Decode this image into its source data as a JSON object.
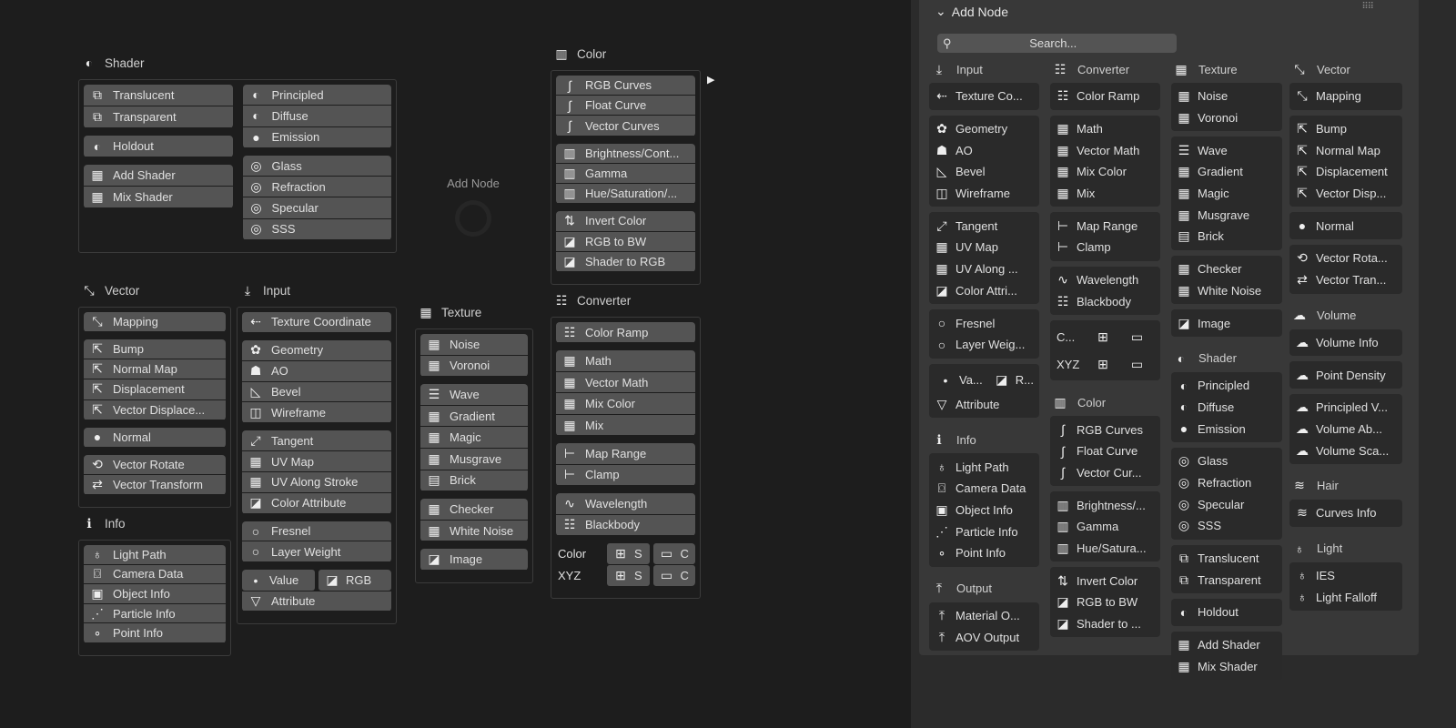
{
  "canvas": {
    "add_node_label": "Add Node",
    "panels": {
      "shader": {
        "title": "Shader",
        "icon": "sphere",
        "columns": [
          [
            [
              [
                "Translucent",
                "translucent"
              ],
              [
                "Transparent",
                "translucent"
              ]
            ],
            [
              [
                "Holdout",
                "sphere"
              ]
            ],
            [
              [
                "Add Shader",
                "checker"
              ],
              [
                "Mix Shader",
                "checker"
              ]
            ]
          ],
          [
            [
              [
                "Principled",
                "sphere"
              ],
              [
                "Diffuse",
                "sphere"
              ],
              [
                "Emission",
                "disc"
              ]
            ],
            [
              [
                "Glass",
                "ring"
              ],
              [
                "Refraction",
                "ring"
              ],
              [
                "Specular",
                "ring"
              ],
              [
                "SSS",
                "ring"
              ]
            ]
          ]
        ]
      },
      "vector": {
        "title": "Vector",
        "icon": "axes",
        "columns": [
          [
            [
              [
                "Mapping",
                "axes"
              ]
            ],
            [
              [
                "Bump",
                "vnode"
              ],
              [
                "Normal Map",
                "vnode"
              ],
              [
                "Displacement",
                "vnode"
              ],
              [
                "Vector Displace...",
                "vnode"
              ]
            ],
            [
              [
                "Normal",
                "disc"
              ]
            ],
            [
              [
                "Vector Rotate",
                "rotate"
              ],
              [
                "Vector Transform",
                "transform"
              ]
            ]
          ]
        ]
      },
      "info": {
        "title": "Info",
        "icon": "info",
        "columns": [
          [
            [
              [
                "Light Path",
                "bulb"
              ],
              [
                "Camera Data",
                "camera"
              ],
              [
                "Object Info",
                "object"
              ],
              [
                "Particle Info",
                "particle"
              ],
              [
                "Point Info",
                "point"
              ]
            ]
          ]
        ]
      },
      "input": {
        "title": "Input",
        "icon": "download",
        "columns": [
          [
            [
              [
                "Texture Coordinate",
                "texco"
              ]
            ],
            [
              [
                "Geometry",
                "geometry"
              ],
              [
                "AO",
                "ghost"
              ],
              [
                "Bevel",
                "bevel"
              ],
              [
                "Wireframe",
                "cube"
              ]
            ],
            [
              [
                "Tangent",
                "tangent"
              ],
              [
                "UV Map",
                "checker"
              ],
              [
                "UV Along Stroke",
                "checker"
              ],
              [
                "Color Attribute",
                "image"
              ]
            ],
            [
              [
                "Fresnel",
                "circle"
              ],
              [
                "Layer Weight",
                "circle"
              ]
            ],
            [
              {
                "split": [
                  [
                    "Value",
                    "dot"
                  ],
                  [
                    "RGB",
                    "image"
                  ]
                ]
              },
              [
                "Attribute",
                "attribute"
              ]
            ]
          ]
        ]
      },
      "texture": {
        "title": "Texture",
        "icon": "checker",
        "columns": [
          [
            [
              [
                "Noise",
                "checker"
              ],
              [
                "Voronoi",
                "checker"
              ]
            ],
            [
              [
                "Wave",
                "wave"
              ],
              [
                "Gradient",
                "checker"
              ],
              [
                "Magic",
                "checker"
              ],
              [
                "Musgrave",
                "checker"
              ],
              [
                "Brick",
                "brick"
              ]
            ],
            [
              [
                "Checker",
                "checker"
              ],
              [
                "White Noise",
                "checker"
              ]
            ],
            [
              [
                "Image",
                "image"
              ]
            ]
          ]
        ]
      },
      "color": {
        "title": "Color",
        "icon": "colorbars",
        "columns": [
          [
            [
              [
                "RGB Curves",
                "curve"
              ],
              [
                "Float Curve",
                "curve"
              ],
              [
                "Vector Curves",
                "curve"
              ]
            ],
            [
              [
                "Brightness/Cont...",
                "colorbars"
              ],
              [
                "Gamma",
                "colorbars"
              ],
              [
                "Hue/Saturation/...",
                "colorbars"
              ]
            ],
            [
              [
                "Invert Color",
                "invert"
              ],
              [
                "RGB to BW",
                "image"
              ],
              [
                "Shader to RGB",
                "image"
              ]
            ]
          ]
        ]
      },
      "converter": {
        "title": "Converter",
        "icon": "sliders",
        "columns": [
          [
            [
              [
                "Color Ramp",
                "sliders"
              ]
            ],
            [
              [
                "Math",
                "checker"
              ],
              [
                "Vector Math",
                "checker"
              ],
              [
                "Mix Color",
                "checker"
              ],
              [
                "Mix",
                "checker"
              ]
            ],
            [
              [
                "Map Range",
                "range"
              ],
              [
                "Clamp",
                "range"
              ]
            ],
            [
              [
                "Wavelength",
                "wave2"
              ],
              [
                "Blackbody",
                "sliders"
              ]
            ],
            [
              {
                "label": "Color",
                "split": [
                  [
                    "S",
                    "combine"
                  ],
                  [
                    "C",
                    "separate"
                  ]
                ]
              },
              {
                "label": "XYZ",
                "split": [
                  [
                    "S",
                    "combine"
                  ],
                  [
                    "C",
                    "separate"
                  ]
                ]
              }
            ]
          ]
        ]
      }
    }
  },
  "sidebar": {
    "title": "Add Node",
    "search_placeholder": "Search...",
    "columns": [
      [
        {
          "title": "Input",
          "icon": "download",
          "blocks": [
            [
              [
                "Texture Co...",
                "texco"
              ]
            ],
            [
              [
                "Geometry",
                "geometry"
              ],
              [
                "AO",
                "ghost"
              ],
              [
                "Bevel",
                "bevel"
              ],
              [
                "Wireframe",
                "cube"
              ]
            ],
            [
              [
                "Tangent",
                "tangent"
              ],
              [
                "UV Map",
                "checker"
              ],
              [
                "UV Along ...",
                "checker"
              ],
              [
                "Color Attri...",
                "image"
              ]
            ],
            [
              [
                "Fresnel",
                "circle"
              ],
              [
                "Layer Weig...",
                "circle"
              ]
            ],
            [
              {
                "split": [
                  [
                    "Va...",
                    "dot"
                  ],
                  [
                    "R...",
                    "image"
                  ]
                ]
              },
              [
                "Attribute",
                "attribute"
              ]
            ]
          ]
        },
        {
          "title": "Info",
          "icon": "info",
          "blocks": [
            [
              [
                "Light Path",
                "bulb"
              ],
              [
                "Camera Data",
                "camera"
              ],
              [
                "Object Info",
                "object"
              ],
              [
                "Particle Info",
                "particle"
              ],
              [
                "Point Info",
                "point"
              ]
            ]
          ]
        },
        {
          "title": "Output",
          "icon": "upload",
          "blocks": [
            [
              [
                "Material O...",
                "upload"
              ],
              [
                "AOV Output",
                "upload"
              ]
            ]
          ]
        }
      ],
      [
        {
          "title": "Converter",
          "icon": "sliders",
          "blocks": [
            [
              [
                "Color Ramp",
                "sliders"
              ]
            ],
            [
              [
                "Math",
                "checker"
              ],
              [
                "Vector Math",
                "checker"
              ],
              [
                "Mix Color",
                "checker"
              ],
              [
                "Mix",
                "checker"
              ]
            ],
            [
              [
                "Map Range",
                "range"
              ],
              [
                "Clamp",
                "range"
              ]
            ],
            [
              [
                "Wavelength",
                "wave2"
              ],
              [
                "Blackbody",
                "sliders"
              ]
            ],
            [
              {
                "label": "C...",
                "split": [
                  [
                    "",
                    "combine"
                  ],
                  [
                    "",
                    "separate"
                  ]
                ]
              },
              {
                "label": "XYZ",
                "split": [
                  [
                    "",
                    "combine"
                  ],
                  [
                    "",
                    "separate"
                  ]
                ]
              }
            ]
          ]
        },
        {
          "title": "Color",
          "icon": "colorbars",
          "blocks": [
            [
              [
                "RGB Curves",
                "curve"
              ],
              [
                "Float Curve",
                "curve"
              ],
              [
                "Vector Cur...",
                "curve"
              ]
            ],
            [
              [
                "Brightness/...",
                "colorbars"
              ],
              [
                "Gamma",
                "colorbars"
              ],
              [
                "Hue/Satura...",
                "colorbars"
              ]
            ],
            [
              [
                "Invert Color",
                "invert"
              ],
              [
                "RGB to BW",
                "image"
              ],
              [
                "Shader to ...",
                "image"
              ]
            ]
          ]
        }
      ],
      [
        {
          "title": "Texture",
          "icon": "checker",
          "blocks": [
            [
              [
                "Noise",
                "checker"
              ],
              [
                "Voronoi",
                "checker"
              ]
            ],
            [
              [
                "Wave",
                "wave"
              ],
              [
                "Gradient",
                "checker"
              ],
              [
                "Magic",
                "checker"
              ],
              [
                "Musgrave",
                "checker"
              ],
              [
                "Brick",
                "brick"
              ]
            ],
            [
              [
                "Checker",
                "checker"
              ],
              [
                "White Noise",
                "checker"
              ]
            ],
            [
              [
                "Image",
                "image"
              ]
            ]
          ]
        },
        {
          "title": "Shader",
          "icon": "sphere",
          "blocks": [
            [
              [
                "Principled",
                "sphere"
              ],
              [
                "Diffuse",
                "sphere"
              ],
              [
                "Emission",
                "disc"
              ]
            ],
            [
              [
                "Glass",
                "ring"
              ],
              [
                "Refraction",
                "ring"
              ],
              [
                "Specular",
                "ring"
              ],
              [
                "SSS",
                "ring"
              ]
            ],
            [
              [
                "Translucent",
                "translucent"
              ],
              [
                "Transparent",
                "translucent"
              ]
            ],
            [
              [
                "Holdout",
                "sphere"
              ]
            ],
            [
              [
                "Add Shader",
                "checker"
              ],
              [
                "Mix Shader",
                "checker"
              ]
            ]
          ]
        }
      ],
      [
        {
          "title": "Vector",
          "icon": "axes",
          "blocks": [
            [
              [
                "Mapping",
                "axes"
              ]
            ],
            [
              [
                "Bump",
                "vnode"
              ],
              [
                "Normal Map",
                "vnode"
              ],
              [
                "Displacement",
                "vnode"
              ],
              [
                "Vector Disp...",
                "vnode"
              ]
            ],
            [
              [
                "Normal",
                "disc"
              ]
            ],
            [
              [
                "Vector Rota...",
                "rotate"
              ],
              [
                "Vector Tran...",
                "transform"
              ]
            ]
          ]
        },
        {
          "title": "Volume",
          "icon": "cloud",
          "blocks": [
            [
              [
                "Volume Info",
                "cloud"
              ]
            ],
            [
              [
                "Point Density",
                "cloud"
              ]
            ],
            [
              [
                "Principled V...",
                "cloud"
              ],
              [
                "Volume Ab...",
                "cloud"
              ],
              [
                "Volume Sca...",
                "cloud"
              ]
            ]
          ]
        },
        {
          "title": "Hair",
          "icon": "hair",
          "blocks": [
            [
              [
                "Curves Info",
                "hair"
              ]
            ]
          ]
        },
        {
          "title": "Light",
          "icon": "bulb",
          "blocks": [
            [
              [
                "IES",
                "bulb"
              ],
              [
                "Light Falloff",
                "bulb"
              ]
            ]
          ]
        }
      ]
    ]
  }
}
